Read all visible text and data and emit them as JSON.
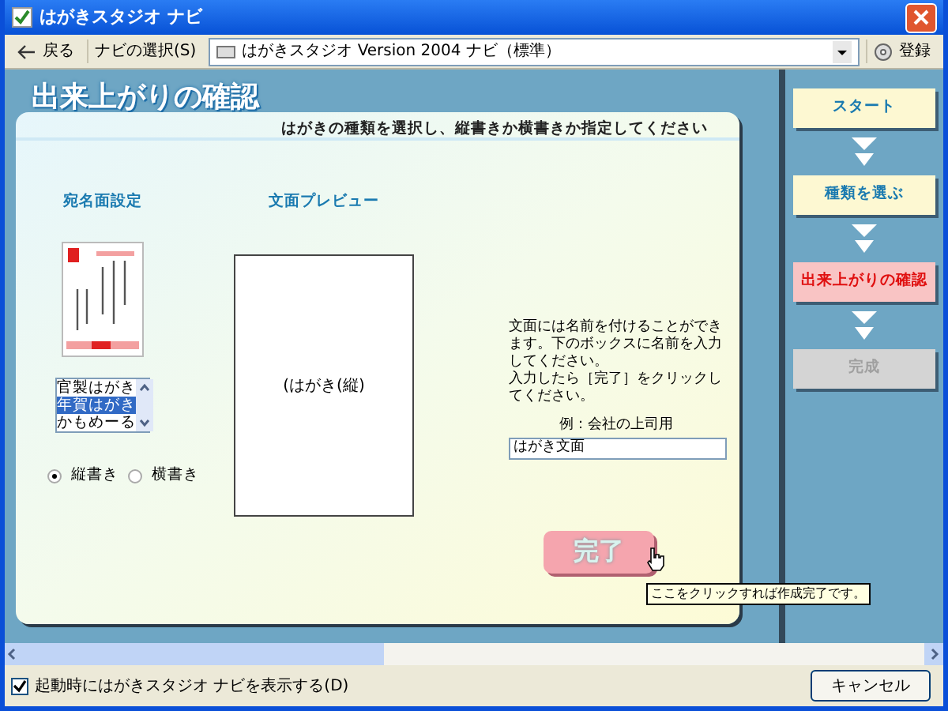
{
  "window": {
    "title": "はがきスタジオ ナビ"
  },
  "toolbar": {
    "back": "戻る",
    "navi_select": "ナビの選択(S)",
    "navi_combo": "はがきスタジオ Version 2004 ナビ（標準）",
    "register": "登録"
  },
  "page": {
    "title": "出来上がりの確認",
    "instruction": "はがきの種類を選択し、縦書きか横書きか指定してください"
  },
  "address_side": {
    "heading": "宛名面設定",
    "types": [
      {
        "label": "官製はがき",
        "selected": false
      },
      {
        "label": "年賀はがき",
        "selected": true
      },
      {
        "label": "かもめーる",
        "selected": false
      }
    ],
    "orientation": [
      {
        "label": "縦書き",
        "selected": true
      },
      {
        "label": "横書き",
        "selected": false
      }
    ]
  },
  "preview": {
    "heading": "文面プレビュー",
    "label": "(はがき(縦)"
  },
  "name_entry": {
    "description": [
      "文面には名前を付けることができます。下のボックスに名前を入力してください。",
      "入力したら［完了］をクリックしてください。"
    ],
    "example": "例：会社の上司用",
    "value": "はがき文面"
  },
  "done_button": "完了",
  "tooltip": "ここをクリックすれば作成完了です。",
  "steps": [
    {
      "label": "スタート",
      "selected": false,
      "disabled": false
    },
    {
      "label": "種類を選ぶ",
      "selected": false,
      "disabled": false
    },
    {
      "label": "出来上がりの確認",
      "selected": true,
      "disabled": false
    },
    {
      "label": "完成",
      "selected": false,
      "disabled": true
    }
  ],
  "footer": {
    "show_on_start": {
      "label": "起動時にはがきスタジオ ナビを表示する(D)",
      "checked": true
    },
    "cancel": "キャンセル"
  }
}
